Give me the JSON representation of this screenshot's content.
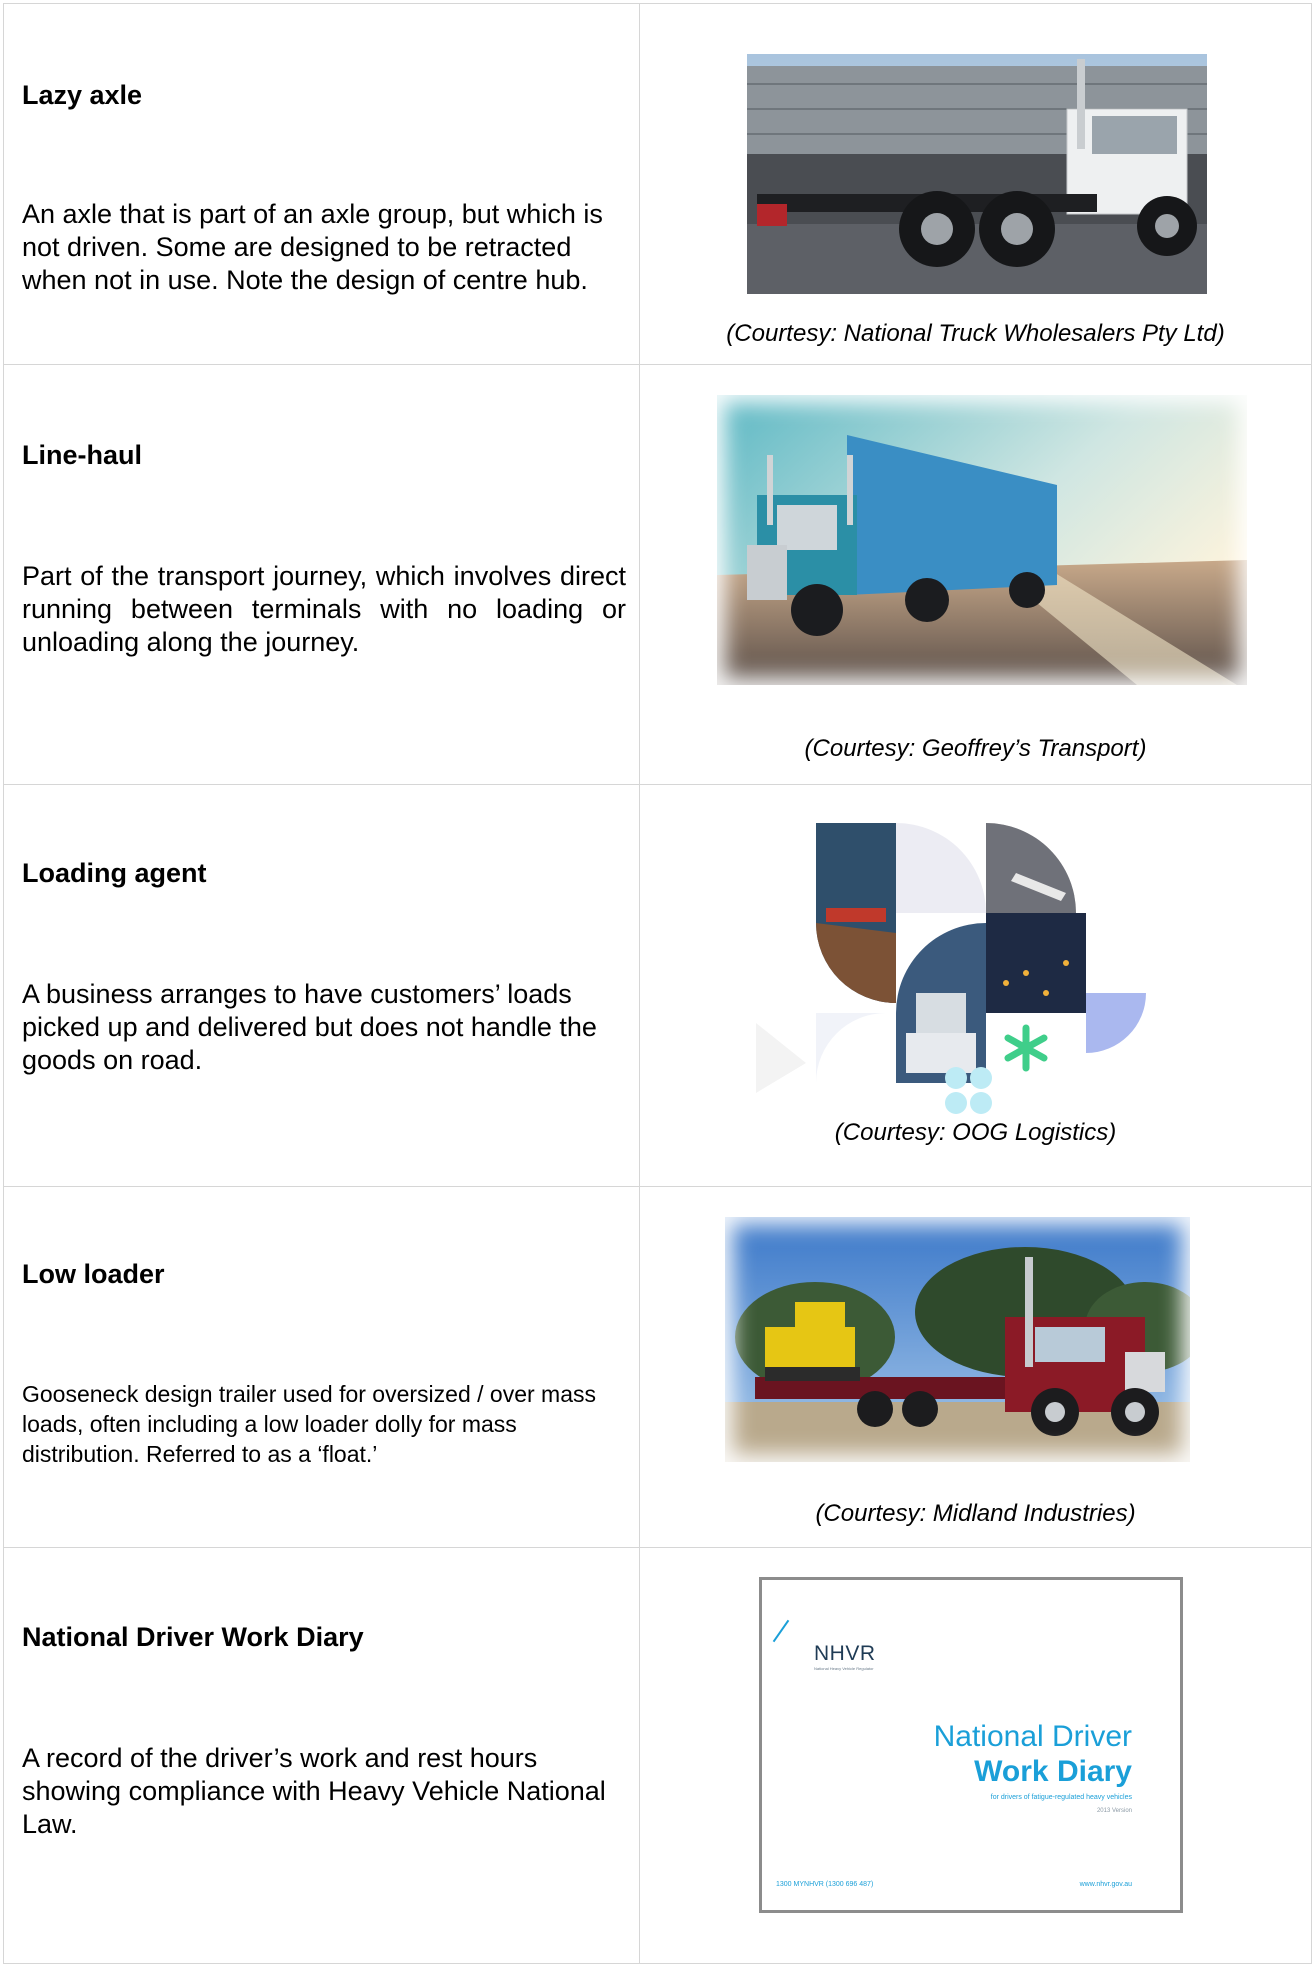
{
  "rows": [
    {
      "term": "Lazy axle",
      "definition": "An axle that is part of an axle group, but which is not driven. Some are designed to be retracted when not in use. Note the design of centre hub.",
      "caption": "(Courtesy: National Truck Wholesalers Pty Ltd)",
      "image_icon": "truck-chassis-photo"
    },
    {
      "term": "Line-haul",
      "definition": "Part of the transport journey, which involves direct running between terminals with no loading or unloading along the journey.",
      "caption": "(Courtesy: Geoffrey’s Transport)",
      "image_icon": "highway-truck-photo"
    },
    {
      "term": "Loading agent",
      "definition": "A business arranges to have customers’ loads picked up and delivered but does not handle the goods on road.",
      "caption": "(Courtesy: OOG Logistics)",
      "image_icon": "logistics-collage-logo"
    },
    {
      "term": "Low loader",
      "definition": "Gooseneck design trailer used for oversized / over mass loads, often including a low loader dolly for mass distribution. Referred to as a ‘float.’",
      "caption": "(Courtesy: Midland Industries)",
      "image_icon": "low-loader-truck-photo"
    },
    {
      "term": "National Driver Work Diary",
      "definition": "A record of the driver’s work and rest hours showing compliance with Heavy Vehicle National Law.",
      "caption": "",
      "image_icon": "work-diary-cover",
      "cover": {
        "logo": "NHVR",
        "logo_sub": "National Heavy Vehicle Regulator",
        "title_line1": "National Driver",
        "title_line2": "Work Diary",
        "subtitle": "for drivers of fatigue-regulated heavy vehicles",
        "version": "2013 Version",
        "phone": "1300 MYNHVR (1300 696 487)",
        "web": "www.nhvr.gov.au"
      }
    }
  ],
  "colors": {
    "border": "#d6d6d6",
    "nhvr_blue": "#1a9fd8",
    "frame": "#8c8c8c"
  }
}
